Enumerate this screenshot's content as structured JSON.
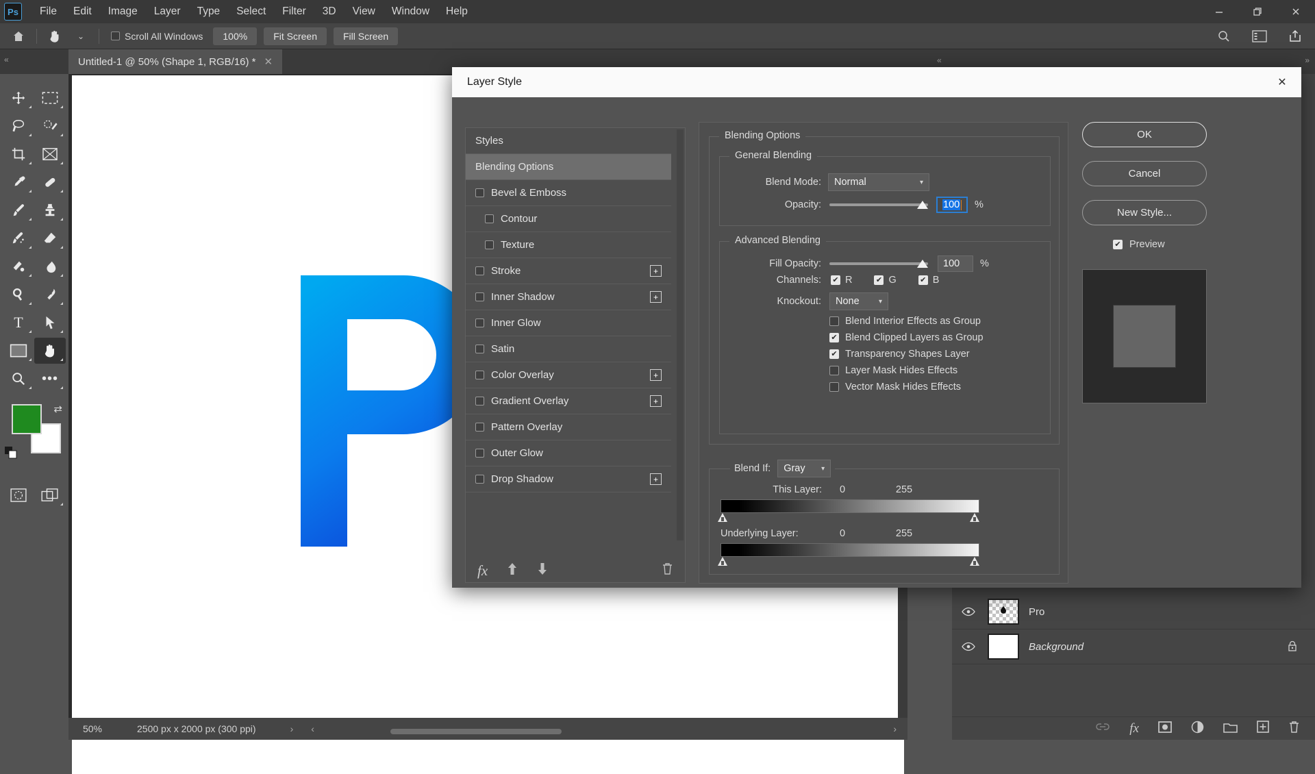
{
  "app": {
    "logo": "Ps",
    "menus": [
      "File",
      "Edit",
      "Image",
      "Layer",
      "Type",
      "Select",
      "Filter",
      "3D",
      "View",
      "Window",
      "Help"
    ],
    "window_controls": {
      "minimize": "—",
      "maximize": "❐",
      "close": "✕"
    }
  },
  "options_bar": {
    "home_icon": "home-icon",
    "tool_icon": "hand-tool-icon",
    "tool_dropdown": "⌄",
    "scroll_all_windows": "Scroll All Windows",
    "zoom_value": "100%",
    "fit_screen": "Fit Screen",
    "fill_screen": "Fill Screen",
    "right_icons": [
      "search-icon",
      "workspace-icon",
      "share-icon"
    ]
  },
  "tabs": {
    "collapse_left": "«",
    "collapse_mid": "«",
    "collapse_right": "»",
    "document": {
      "title": "Untitled-1 @ 50% (Shape 1, RGB/16) *",
      "close": "✕"
    }
  },
  "toolbar": {
    "tools": [
      {
        "name": "move-tool",
        "glyph": "✥"
      },
      {
        "name": "marquee-tool",
        "glyph": "▭"
      },
      {
        "name": "lasso-tool",
        "glyph": "➲"
      },
      {
        "name": "object-select-tool",
        "glyph": "◌"
      },
      {
        "name": "crop-tool",
        "glyph": "⌗"
      },
      {
        "name": "frame-tool",
        "glyph": "⊠"
      },
      {
        "name": "eyedropper-tool",
        "glyph": "⌇"
      },
      {
        "name": "healing-brush-tool",
        "glyph": "⊘"
      },
      {
        "name": "brush-tool",
        "glyph": "✎"
      },
      {
        "name": "clone-stamp-tool",
        "glyph": "⎙"
      },
      {
        "name": "history-brush-tool",
        "glyph": "✐"
      },
      {
        "name": "eraser-tool",
        "glyph": "◣"
      },
      {
        "name": "gradient-tool",
        "glyph": "◨"
      },
      {
        "name": "blur-tool",
        "glyph": "◐"
      },
      {
        "name": "dodge-tool",
        "glyph": "◉"
      },
      {
        "name": "pen-tool",
        "glyph": "✒"
      },
      {
        "name": "type-tool",
        "glyph": "T"
      },
      {
        "name": "path-selection-tool",
        "glyph": "➤"
      },
      {
        "name": "rectangle-tool",
        "glyph": "▢"
      },
      {
        "name": "hand-tool",
        "glyph": "✋",
        "selected": true
      },
      {
        "name": "zoom-tool",
        "glyph": "⌕"
      },
      {
        "name": "more-tools",
        "glyph": "•••"
      }
    ],
    "foreground_color": "#1f8a1f",
    "background_color": "#ffffff",
    "swap_icon": "⇄",
    "quick_mask_icon": "quick-mask-icon",
    "screen_mode_icon": "screen-mode-icon"
  },
  "status_bar": {
    "zoom": "50%",
    "doc_size": "2500 px x 2000 px (300 ppi)",
    "arrow_right": "›",
    "nav_left": "‹",
    "nav_right": "›"
  },
  "layers_panel": {
    "layers": [
      {
        "name": "Pro",
        "kind": "shape",
        "locked": false,
        "eye": "👁"
      },
      {
        "name": "Background",
        "kind": "background",
        "locked": true,
        "eye": "👁",
        "lock_icon": "lock-icon"
      }
    ],
    "footer_icons": [
      "link-icon",
      "fx-icon",
      "mask-icon",
      "adjustment-icon",
      "group-icon",
      "new-layer-icon",
      "delete-layer-icon"
    ]
  },
  "dialog": {
    "title": "Layer Style",
    "close": "✕",
    "styles_header": "Styles",
    "style_items": [
      {
        "label": "Blending Options",
        "checkbox": false,
        "active": true,
        "indent": false,
        "plus": false
      },
      {
        "label": "Bevel & Emboss",
        "checkbox": true,
        "checked": false,
        "active": false,
        "indent": false,
        "plus": false
      },
      {
        "label": "Contour",
        "checkbox": true,
        "checked": false,
        "active": false,
        "indent": true,
        "plus": false
      },
      {
        "label": "Texture",
        "checkbox": true,
        "checked": false,
        "active": false,
        "indent": true,
        "plus": false
      },
      {
        "label": "Stroke",
        "checkbox": true,
        "checked": false,
        "active": false,
        "indent": false,
        "plus": true
      },
      {
        "label": "Inner Shadow",
        "checkbox": true,
        "checked": false,
        "active": false,
        "indent": false,
        "plus": true
      },
      {
        "label": "Inner Glow",
        "checkbox": true,
        "checked": false,
        "active": false,
        "indent": false,
        "plus": false
      },
      {
        "label": "Satin",
        "checkbox": true,
        "checked": false,
        "active": false,
        "indent": false,
        "plus": false
      },
      {
        "label": "Color Overlay",
        "checkbox": true,
        "checked": false,
        "active": false,
        "indent": false,
        "plus": true
      },
      {
        "label": "Gradient Overlay",
        "checkbox": true,
        "checked": false,
        "active": false,
        "indent": false,
        "plus": true
      },
      {
        "label": "Pattern Overlay",
        "checkbox": true,
        "checked": false,
        "active": false,
        "indent": false,
        "plus": false
      },
      {
        "label": "Outer Glow",
        "checkbox": true,
        "checked": false,
        "active": false,
        "indent": false,
        "plus": false
      },
      {
        "label": "Drop Shadow",
        "checkbox": true,
        "checked": false,
        "active": false,
        "indent": false,
        "plus": true
      }
    ],
    "style_footer": {
      "fx_icon": "fx-icon",
      "up_icon": "▲",
      "down_icon": "▼",
      "trash_icon": "🗑"
    },
    "plus_glyph": "+",
    "blending_options_label": "Blending Options",
    "general_blending": {
      "legend": "General Blending",
      "blend_mode_label": "Blend Mode:",
      "blend_mode_value": "Normal",
      "opacity_label": "Opacity:",
      "opacity_value": "100",
      "opacity_unit": "%",
      "opacity_percent": 100
    },
    "advanced_blending": {
      "legend": "Advanced Blending",
      "fill_opacity_label": "Fill Opacity:",
      "fill_opacity_value": "100",
      "fill_opacity_unit": "%",
      "fill_opacity_percent": 100,
      "channels_label": "Channels:",
      "channels": [
        {
          "label": "R",
          "checked": true
        },
        {
          "label": "G",
          "checked": true
        },
        {
          "label": "B",
          "checked": true
        }
      ],
      "knockout_label": "Knockout:",
      "knockout_value": "None",
      "checkboxes": [
        {
          "label": "Blend Interior Effects as Group",
          "checked": false
        },
        {
          "label": "Blend Clipped Layers as Group",
          "checked": true
        },
        {
          "label": "Transparency Shapes Layer",
          "checked": true
        },
        {
          "label": "Layer Mask Hides Effects",
          "checked": false
        },
        {
          "label": "Vector Mask Hides Effects",
          "checked": false
        }
      ]
    },
    "blend_if": {
      "legend": "",
      "label": "Blend If:",
      "channel_value": "Gray",
      "this_layer_label": "This Layer:",
      "this_layer_min": "0",
      "this_layer_max": "255",
      "underlying_layer_label": "Underlying Layer:",
      "underlying_layer_min": "0",
      "underlying_layer_max": "255"
    },
    "buttons": {
      "ok": "OK",
      "cancel": "Cancel",
      "new_style": "New Style...",
      "preview_label": "Preview",
      "preview_checked": true
    }
  },
  "colors": {
    "accent_blue": "#1473e6",
    "dialog_bg": "#535353",
    "panel_bg": "#4e4e4e",
    "foreground_swatch": "#1f8a1f"
  }
}
